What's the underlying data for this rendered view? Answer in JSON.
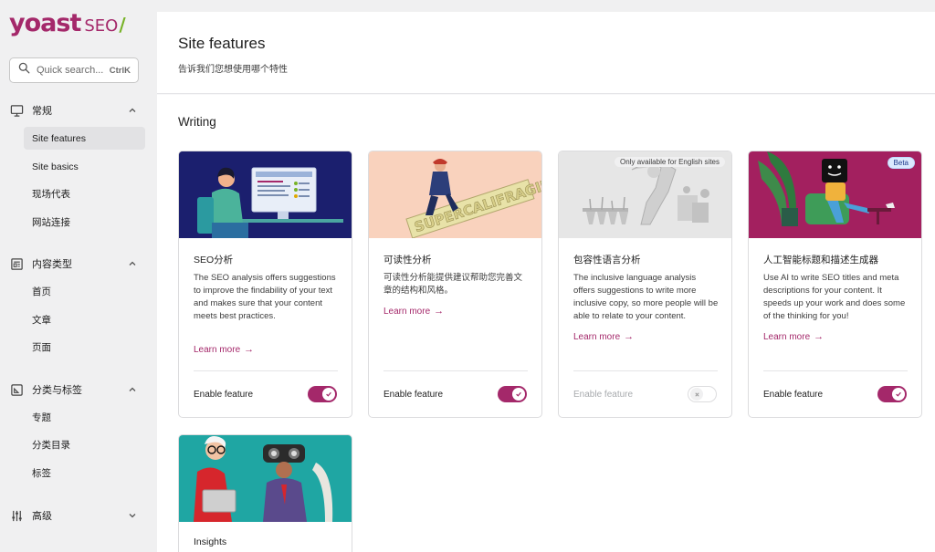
{
  "logo": {
    "name": "yoast",
    "suffix": "SEO",
    "slash": "/"
  },
  "search": {
    "placeholder": "Quick search...",
    "shortcut": "CtrlK"
  },
  "nav": {
    "general": {
      "label": "常规",
      "items": [
        "Site features",
        "Site basics",
        "现场代表",
        "网站连接"
      ]
    },
    "content_types": {
      "label": "内容类型",
      "items": [
        "首页",
        "文章",
        "页面"
      ]
    },
    "categories_tags": {
      "label": "分类与标签",
      "items": [
        "专题",
        "分类目录",
        "标签"
      ]
    },
    "advanced": {
      "label": "高级"
    }
  },
  "page": {
    "title": "Site features",
    "subtitle": "告诉我们您想使用哪个特性"
  },
  "section": {
    "title": "Writing"
  },
  "cards": [
    {
      "title": "SEO分析",
      "desc": "The SEO analysis offers suggestions to improve the findability of your text and makes sure that your content meets best practices.",
      "learn": "Learn more",
      "enable": "Enable feature",
      "enabled": true
    },
    {
      "title": "可读性分析",
      "desc": "可读性分析能提供建议帮助您完善文章的结构和风格。",
      "learn": "Learn more",
      "enable": "Enable feature",
      "enabled": true
    },
    {
      "title": "包容性语言分析",
      "badge": "Only available for English sites",
      "desc": "The inclusive language analysis offers suggestions to write more inclusive copy, so more people will be able to relate to your content.",
      "learn": "Learn more",
      "enable": "Enable feature",
      "enabled": false
    },
    {
      "title": "人工智能标题和描述生成器",
      "badge": "Beta",
      "desc": "Use AI to write SEO titles and meta descriptions for your content. It speeds up your work and does some of the thinking for you!",
      "learn": "Learn more",
      "enable": "Enable feature",
      "enabled": true
    },
    {
      "title": "Insights"
    }
  ],
  "colors": {
    "brand": "#a4286a",
    "accent_green": "#77b227",
    "beta_bg": "#dbeafe"
  },
  "icons": [
    "search-icon",
    "monitor-icon",
    "document-icon",
    "tag-icon",
    "sliders-icon",
    "chevron-up-icon",
    "chevron-down-icon",
    "arrow-right-icon",
    "check-icon",
    "x-icon"
  ]
}
